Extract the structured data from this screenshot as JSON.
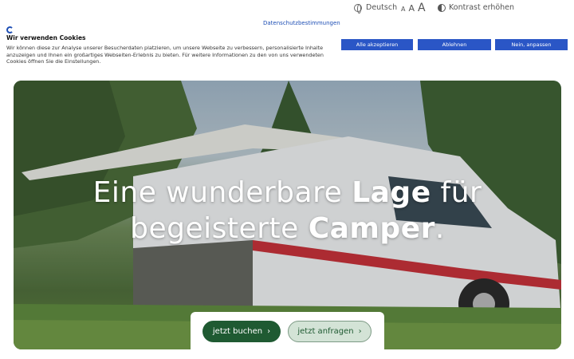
{
  "topbar": {
    "language": "Deutsch",
    "font_small": "A",
    "font_medium": "A",
    "font_large": "A",
    "contrast": "Kontrast erhöhen"
  },
  "cookie": {
    "privacy_link": "Datenschutzbestimmungen",
    "title": "Wir verwenden Cookies",
    "text": "Wir können diese zur Analyse unserer Besucherdaten platzieren, um unsere Webseite zu verbessern, personalisierte Inhalte anzuzeigen und Ihnen ein großartiges Webseiten-Erlebnis zu bieten. Für weitere Informationen zu den von uns verwendeten Cookies öffnen Sie die Einstellungen.",
    "accept_label": "Alle akzeptieren",
    "decline_label": "Ablehnen",
    "adjust_label": "Nein, anpassen"
  },
  "hero": {
    "line1_a": "Eine wunderbare ",
    "line1_b": "Lage",
    "line1_c": " für",
    "line2_a": "begeisterte ",
    "line2_b": "Camper",
    "line2_c": "."
  },
  "cta": {
    "book_label": "jetzt buchen",
    "inquire_label": "jetzt anfragen"
  },
  "colors": {
    "brand_blue": "#2a56c6",
    "brand_green": "#1f5a32",
    "light_green": "#d3e3d6"
  }
}
